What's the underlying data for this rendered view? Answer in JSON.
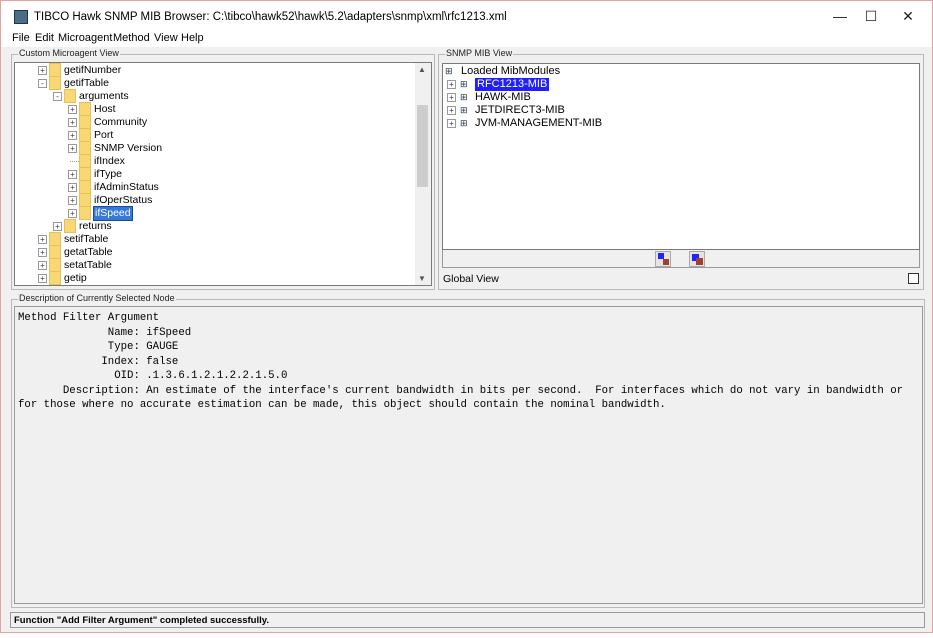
{
  "window": {
    "title": "TIBCO Hawk SNMP MIB Browser: C:\\tibco\\hawk52\\hawk\\5.2\\adapters\\snmp\\xml\\rfc1213.xml",
    "minimize": "—",
    "maximize": "☐",
    "close": "✕"
  },
  "menu": [
    "File",
    "Edit",
    "Microagent",
    "Method",
    "View",
    "Help"
  ],
  "left_panel": {
    "title": "Custom Microagent View",
    "tree": [
      {
        "label": "getifNumber",
        "level": 0,
        "toggle": "+"
      },
      {
        "label": "getifTable",
        "level": 0,
        "toggle": "-"
      },
      {
        "label": "arguments",
        "level": 1,
        "toggle": "-"
      },
      {
        "label": "Host",
        "level": 2,
        "toggle": "+"
      },
      {
        "label": "Community",
        "level": 2,
        "toggle": "+"
      },
      {
        "label": "Port",
        "level": 2,
        "toggle": "+"
      },
      {
        "label": "SNMP Version",
        "level": 2,
        "toggle": "+"
      },
      {
        "label": "ifIndex",
        "level": 2,
        "toggle": ""
      },
      {
        "label": "ifType",
        "level": 2,
        "toggle": "+"
      },
      {
        "label": "ifAdminStatus",
        "level": 2,
        "toggle": "+"
      },
      {
        "label": "ifOperStatus",
        "level": 2,
        "toggle": "+"
      },
      {
        "label": "ifSpeed",
        "level": 2,
        "toggle": "+",
        "selected": true
      },
      {
        "label": "returns",
        "level": 1,
        "toggle": "+"
      },
      {
        "label": "setifTable",
        "level": 0,
        "toggle": "+"
      },
      {
        "label": "getatTable",
        "level": 0,
        "toggle": "+"
      },
      {
        "label": "setatTable",
        "level": 0,
        "toggle": "+"
      },
      {
        "label": "getip",
        "level": 0,
        "toggle": "+"
      }
    ]
  },
  "right_panel": {
    "title": "SNMP MIB View",
    "root": "Loaded MibModules",
    "modules": [
      {
        "label": "RFC1213-MIB",
        "selected": true
      },
      {
        "label": "HAWK-MIB"
      },
      {
        "label": "JETDIRECT3-MIB"
      },
      {
        "label": "JVM-MANAGEMENT-MIB"
      }
    ],
    "global_view_label": "Global View",
    "global_view_checked": false
  },
  "description": {
    "title": "Description of Currently Selected Node",
    "lines": [
      "Method Filter Argument",
      "              Name: ifSpeed",
      "              Type: GAUGE",
      "             Index: false",
      "               OID: .1.3.6.1.2.1.2.2.1.5.0",
      "       Description: An estimate of the interface's current bandwidth in bits per second.  For interfaces which do not vary in bandwidth or",
      "for those where no accurate estimation can be made, this object should contain the nominal bandwidth."
    ]
  },
  "status": "Function \"Add Filter Argument\" completed successfully."
}
